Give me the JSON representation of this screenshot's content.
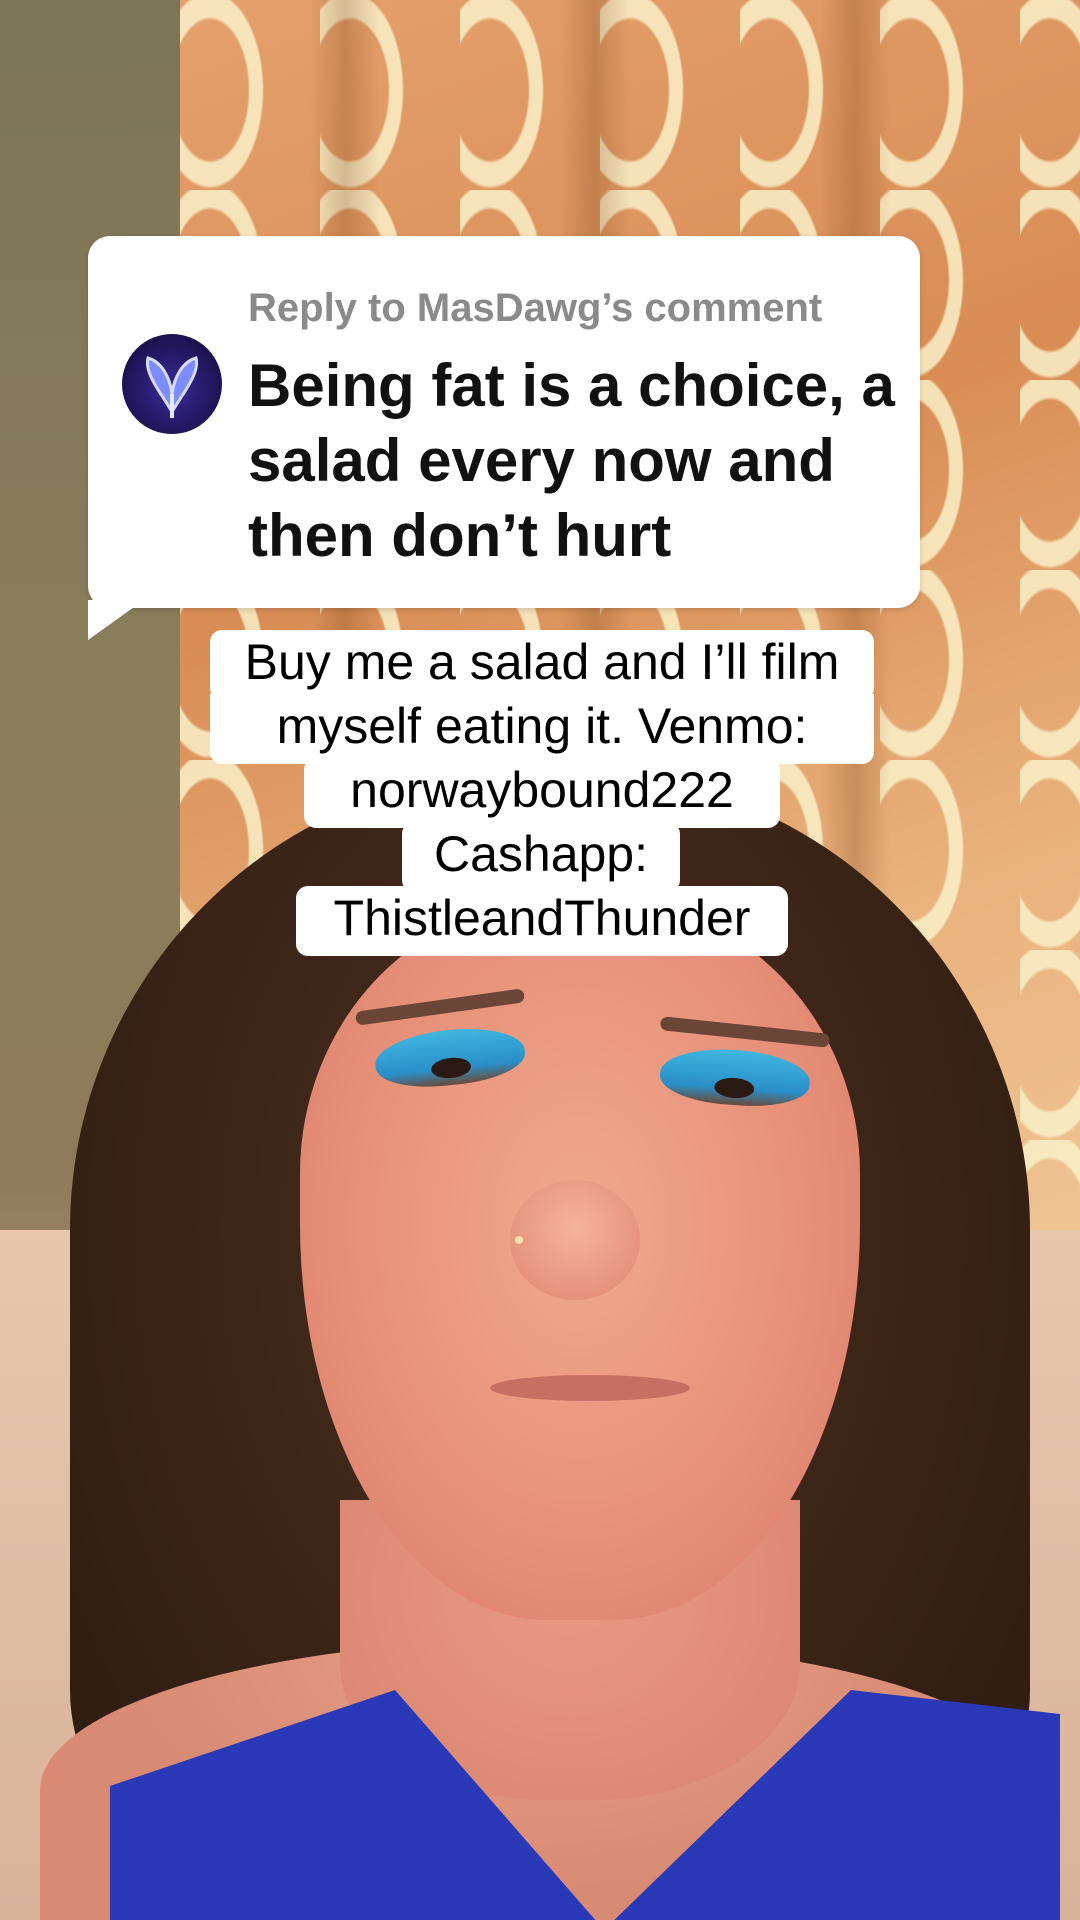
{
  "reply_card": {
    "header": "Reply to MasDawg’s comment",
    "comment": "Being fat is a choice, a salad every now and then don’t hurt",
    "avatar_icon": "butterfly-avatar-icon"
  },
  "caption": {
    "lines": [
      "Buy me a salad and I’ll film",
      "myself eating it. Venmo:",
      "norwaybound222",
      "Cashapp:",
      "ThistleandThunder"
    ]
  },
  "colors": {
    "bubble_bg": "#ffffff",
    "header_text": "#8a8a8a",
    "comment_text": "#111111",
    "caption_text": "#000000"
  }
}
